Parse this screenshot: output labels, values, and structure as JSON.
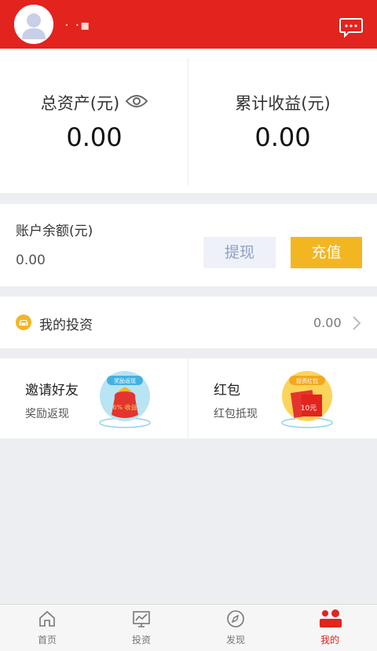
{
  "header": {
    "username": "· ·▪",
    "message_icon": "chat-bubble-icon",
    "background": "#e3231d"
  },
  "assets": {
    "total_label": "总资产(元)",
    "total_value": "0.00",
    "earnings_label": "累计收益(元)",
    "earnings_value": "0.00",
    "eye_icon": "eye-icon"
  },
  "balance": {
    "label": "账户余额(元)",
    "value": "0.00",
    "withdraw_label": "提现",
    "recharge_label": "充值",
    "recharge_color": "#f3b623"
  },
  "investments": {
    "label": "我的投资",
    "value": "0.00",
    "icon": "car-icon"
  },
  "promos": [
    {
      "title": "邀请好友",
      "subtitle": "奖励返现",
      "badge": "奖励返现",
      "art_text": "6% 收益"
    },
    {
      "title": "红包",
      "subtitle": "红包抵现",
      "badge": "投资红包",
      "art_text": "10元"
    }
  ],
  "tabs": [
    {
      "label": "首页",
      "icon": "home-icon"
    },
    {
      "label": "投资",
      "icon": "chart-icon"
    },
    {
      "label": "发现",
      "icon": "compass-icon"
    },
    {
      "label": "我的",
      "icon": "user-icon",
      "active": true
    }
  ]
}
